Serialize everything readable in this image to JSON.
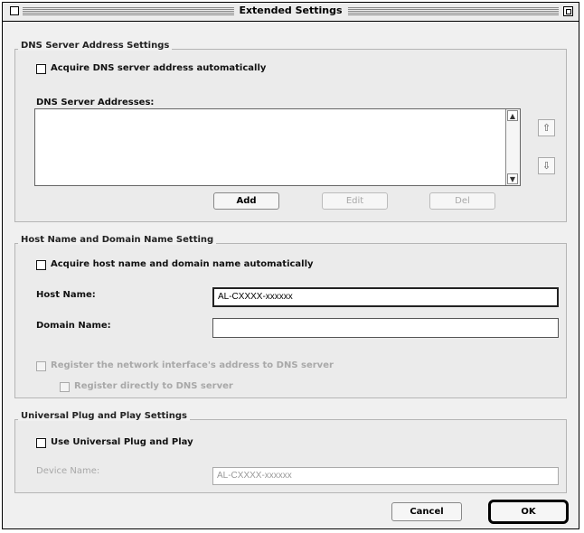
{
  "window": {
    "title": "Extended Settings"
  },
  "dns": {
    "group_label": "DNS Server Address Settings",
    "auto_label": "Acquire DNS server address automatically",
    "list_label": "DNS Server Addresses:",
    "add_label": "Add",
    "edit_label": "Edit",
    "del_label": "Del",
    "up_glyph": "⇧",
    "down_glyph": "⇩"
  },
  "host": {
    "group_label": "Host Name and Domain Name Setting",
    "auto_label": "Acquire host name and domain name automatically",
    "host_label": "Host Name:",
    "host_value": "AL-CXXXX-xxxxxx",
    "domain_label": "Domain Name:",
    "domain_value": "",
    "register_label": "Register the network interface's address to DNS server",
    "register_direct_label": "Register directly to DNS server"
  },
  "upnp": {
    "group_label": "Universal Plug and Play Settings",
    "use_label": "Use Universal Plug and Play",
    "device_label": "Device Name:",
    "device_value": "AL-CXXXX-xxxxxx"
  },
  "footer": {
    "cancel_label": "Cancel",
    "ok_label": "OK"
  },
  "icons": {
    "close": "close-box-icon",
    "zoom": "zoom-box-icon",
    "move_up": "move-up-icon",
    "move_down": "move-down-icon"
  }
}
